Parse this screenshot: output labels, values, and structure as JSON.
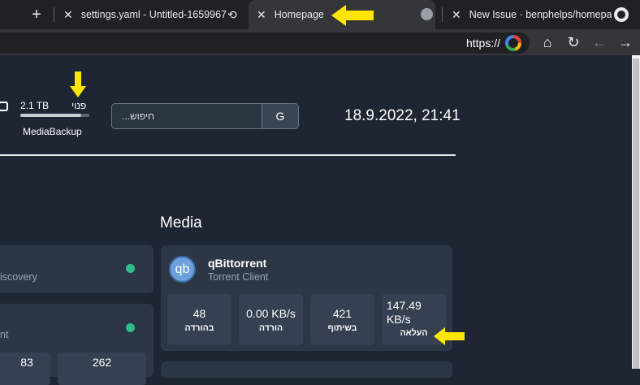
{
  "browser": {
    "tabs": [
      {
        "label": "",
        "icon": "plus-icon"
      },
      {
        "label": "settings.yaml - Untitled-1659967",
        "icon": "close-icon"
      },
      {
        "label": "Homepage",
        "icon": "close-icon",
        "active": true
      },
      {
        "label": "New Issue · benphelps/homepage",
        "icon": "close-icon"
      }
    ],
    "address": "https://",
    "colors": {
      "accent": "#ffe600",
      "background": "#1e2633",
      "status_ok": "#2ebc8a"
    }
  },
  "header": {
    "disk": {
      "total": "2.1 TB",
      "free_label": "פנוי",
      "usage_fraction": 0.88,
      "name": "MediaBackup"
    },
    "search": {
      "placeholder": "...חיפוש",
      "provider": "G"
    },
    "datetime": "18.9.2022, 21:41"
  },
  "left_column": {
    "card1_text": "iscovery",
    "card2_text": "nt",
    "card2_stats": [
      "83",
      "262"
    ]
  },
  "media": {
    "title": "Media",
    "service": {
      "icon_text": "qb",
      "name": "qBittorrent",
      "description": "Torrent Client",
      "stats": [
        {
          "value": "48",
          "label": "בהורדה"
        },
        {
          "value": "0.00 KB/s",
          "label": "הורדה"
        },
        {
          "value": "421",
          "label": "בשיתוף"
        },
        {
          "value": "147.49 KB/s",
          "label": "העלאה"
        }
      ]
    }
  }
}
